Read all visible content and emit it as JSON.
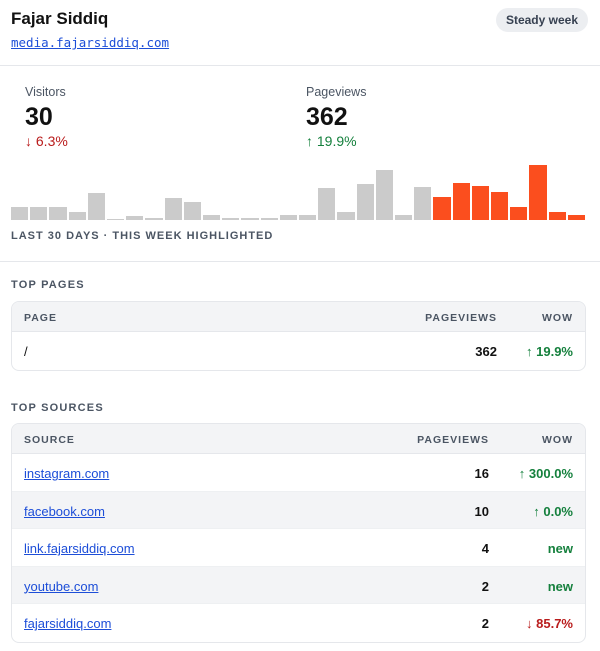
{
  "header": {
    "site_name": "Fajar Siddiq",
    "site_url": "media.fajarsiddiq.com",
    "badge": "Steady week"
  },
  "stats": {
    "visitors": {
      "label": "Visitors",
      "value": "30",
      "change": "↓ 6.3%",
      "direction": "down"
    },
    "pageviews": {
      "label": "Pageviews",
      "value": "362",
      "change": "↑ 19.9%",
      "direction": "up"
    }
  },
  "chart_data": {
    "type": "bar",
    "title": "",
    "xlabel": "",
    "ylabel": "",
    "caption": "LAST 30 DAYS · THIS WEEK HIGHLIGHTED",
    "values": [
      13,
      13,
      13,
      8,
      27,
      1,
      4,
      2,
      22,
      18,
      5,
      2,
      2,
      2,
      5,
      5,
      32,
      8,
      36,
      50,
      5,
      33,
      23,
      37,
      34,
      28,
      13,
      55,
      8,
      5
    ],
    "highlighted_days": [
      23,
      24,
      25,
      26,
      27,
      28,
      29,
      30
    ],
    "colors": {
      "default": "#cbcbcb",
      "highlight": "#fb4e1e"
    }
  },
  "top_pages": {
    "title": "TOP PAGES",
    "columns": {
      "page": "PAGE",
      "pageviews": "PAGEVIEWS",
      "wow": "WOW"
    },
    "rows": [
      {
        "page": "/",
        "pageviews": "362",
        "wow": "↑ 19.9%",
        "direction": "up"
      }
    ]
  },
  "top_sources": {
    "title": "TOP SOURCES",
    "columns": {
      "source": "SOURCE",
      "pageviews": "PAGEVIEWS",
      "wow": "WOW"
    },
    "rows": [
      {
        "source": "instagram.com",
        "pageviews": "16",
        "wow": "↑ 300.0%",
        "direction": "up"
      },
      {
        "source": "facebook.com",
        "pageviews": "10",
        "wow": "↑ 0.0%",
        "direction": "up"
      },
      {
        "source": "link.fajarsiddiq.com",
        "pageviews": "4",
        "wow": "new",
        "direction": "new"
      },
      {
        "source": "youtube.com",
        "pageviews": "2",
        "wow": "new",
        "direction": "new"
      },
      {
        "source": "fajarsiddiq.com",
        "pageviews": "2",
        "wow": "↓ 85.7%",
        "direction": "down"
      }
    ]
  }
}
